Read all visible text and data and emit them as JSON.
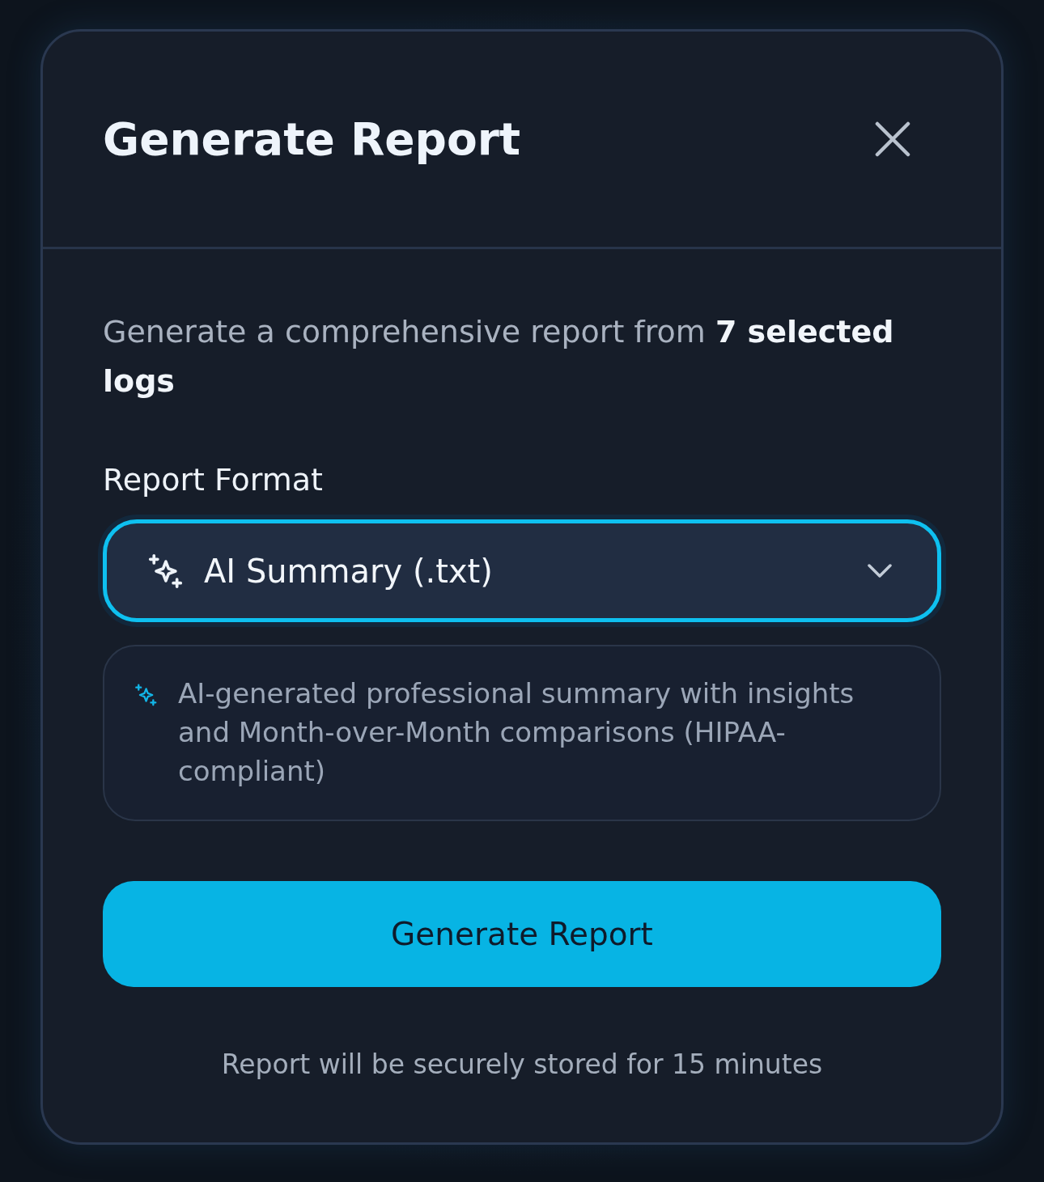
{
  "dialog": {
    "title": "Generate Report",
    "description": "Generate a comprehensive report from **7 selected logs**",
    "report_format": {
      "label": "Report Format",
      "value": "AI Summary (.txt)",
      "focused": true,
      "option_description": "AI-generated professional summary with insights and Month-over-Month comparisons (HIPAA-compliant)"
    },
    "primary_button": "Generate Report",
    "footnote": "Report will be securely stored for 15 minutes"
  }
}
